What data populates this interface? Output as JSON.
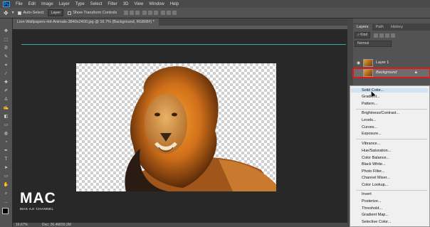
{
  "app": {
    "logo": "Ps"
  },
  "menubar": {
    "items": [
      "File",
      "Edit",
      "Image",
      "Layer",
      "Type",
      "Select",
      "Filter",
      "3D",
      "View",
      "Window",
      "Help"
    ]
  },
  "options": {
    "auto_select_label": "Auto-Select:",
    "auto_select_value": "Layer",
    "show_transform_label": "Show Transform Controls"
  },
  "document": {
    "tab_title": "Lion-Wallpapers-Hd-Animals-3840x2400.jpg @ 16.7% (Background, RGB/8#) *"
  },
  "status": {
    "zoom": "16.67%",
    "doc_size": "Doc: 26.4M/30.3M"
  },
  "watermark": {
    "logo": "MAC",
    "subtitle": "MAS AJI CHANNEL"
  },
  "layers_panel": {
    "tabs": [
      "Layers",
      "Path",
      "History"
    ],
    "kind_label": "Kind",
    "blend_mode": "Normal",
    "layers": [
      {
        "name": "Layer 1"
      },
      {
        "name": "Background"
      }
    ]
  },
  "context_menu": {
    "groups": [
      [
        "Solid Color...",
        "Gradient...",
        "Pattern..."
      ],
      [
        "Brightness/Contrast...",
        "Levels...",
        "Curves...",
        "Exposure..."
      ],
      [
        "Vibrance...",
        "Hue/Saturation...",
        "Color Balance...",
        "Black  White...",
        "Photo Filter...",
        "Channel Mixer...",
        "Color Lookup..."
      ],
      [
        "Invert",
        "Posterize...",
        "Threshold...",
        "Gradient Map...",
        "Selective Color..."
      ]
    ],
    "highlighted": "Solid Color..."
  },
  "colors": {
    "selection_outline": "#e01818",
    "guide": "#3fa9a0",
    "menu_highlight": "#cfe3f7"
  }
}
